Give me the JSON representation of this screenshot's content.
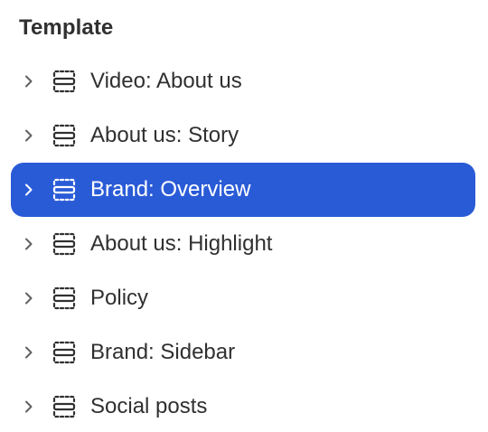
{
  "panel": {
    "heading": "Template",
    "items": [
      {
        "label": "Video: About us",
        "selected": false
      },
      {
        "label": "About us: Story",
        "selected": false
      },
      {
        "label": "Brand: Overview",
        "selected": true
      },
      {
        "label": "About us: Highlight",
        "selected": false
      },
      {
        "label": "Policy",
        "selected": false
      },
      {
        "label": "Brand: Sidebar",
        "selected": false
      },
      {
        "label": "Social posts",
        "selected": false
      }
    ]
  },
  "icons": {
    "expand": "chevron-right-icon",
    "section": "section-icon"
  },
  "colors": {
    "selected_background": "#2a5bd7",
    "selected_text": "#ffffff",
    "text": "#303030"
  }
}
